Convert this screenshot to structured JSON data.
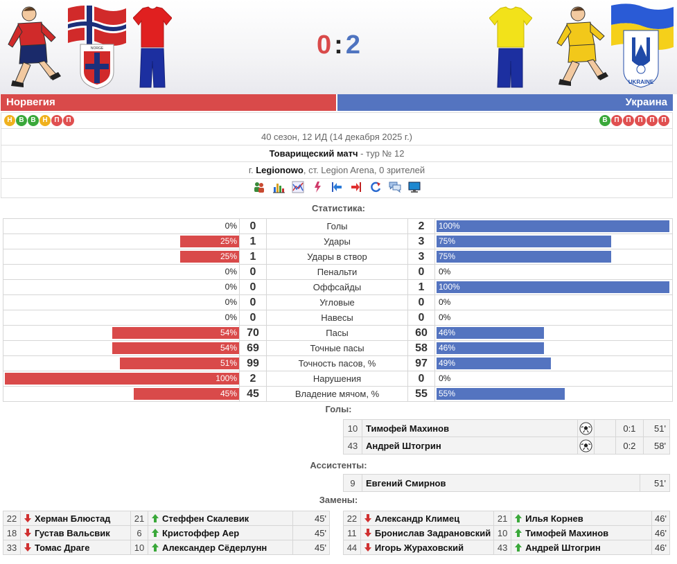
{
  "match": {
    "home_team": "Норвегия",
    "away_team": "Украина",
    "home_score": "0",
    "score_sep": ":",
    "away_score": "2",
    "home_form": [
      "Н",
      "В",
      "В",
      "Н",
      "П",
      "П"
    ],
    "away_form": [
      "В",
      "П",
      "П",
      "П",
      "П",
      "П"
    ],
    "season_info": "40 сезон, 12 ИД (14 декабря 2025 г.)",
    "match_type": "Товарищеский матч",
    "round": " - тур № 12",
    "city_prefix": "г. ",
    "city": "Legionowo",
    "venue": ", ст. Legion Arena, 0 зрителей",
    "ukraine_badge_text": "UKRAINE",
    "norway_badge_text": "NORGE"
  },
  "toolbar_icons": [
    "players-icon",
    "bar-chart-icon",
    "line-chart-icon",
    "events-icon",
    "arrow-left-icon",
    "arrow-right-icon",
    "refresh-icon",
    "comments-icon",
    "monitor-icon"
  ],
  "colors": {
    "home": "#d94a4a",
    "away": "#5474c0",
    "form_win": "#3aa83a",
    "form_draw": "#f0b11e",
    "form_loss": "#e05050"
  },
  "sections": {
    "stats": "Статистика:",
    "goals": "Голы:",
    "assists": "Ассистенты:",
    "subs": "Замены:"
  },
  "stats": [
    {
      "label": "Голы",
      "home": "0",
      "away": "2",
      "home_pct": "0%",
      "away_pct": "100%",
      "home_frac": 0,
      "away_frac": 1.0
    },
    {
      "label": "Удары",
      "home": "1",
      "away": "3",
      "home_pct": "25%",
      "away_pct": "75%",
      "home_frac": 0.25,
      "away_frac": 0.75
    },
    {
      "label": "Удары в створ",
      "home": "1",
      "away": "3",
      "home_pct": "25%",
      "away_pct": "75%",
      "home_frac": 0.25,
      "away_frac": 0.75
    },
    {
      "label": "Пенальти",
      "home": "0",
      "away": "0",
      "home_pct": "0%",
      "away_pct": "0%",
      "home_frac": 0,
      "away_frac": 0
    },
    {
      "label": "Оффсайды",
      "home": "0",
      "away": "1",
      "home_pct": "0%",
      "away_pct": "100%",
      "home_frac": 0,
      "away_frac": 1.0
    },
    {
      "label": "Угловые",
      "home": "0",
      "away": "0",
      "home_pct": "0%",
      "away_pct": "0%",
      "home_frac": 0,
      "away_frac": 0
    },
    {
      "label": "Навесы",
      "home": "0",
      "away": "0",
      "home_pct": "0%",
      "away_pct": "0%",
      "home_frac": 0,
      "away_frac": 0
    },
    {
      "label": "Пасы",
      "home": "70",
      "away": "60",
      "home_pct": "54%",
      "away_pct": "46%",
      "home_frac": 0.54,
      "away_frac": 0.46
    },
    {
      "label": "Точные пасы",
      "home": "69",
      "away": "58",
      "home_pct": "54%",
      "away_pct": "46%",
      "home_frac": 0.54,
      "away_frac": 0.46
    },
    {
      "label": "Точность пасов, %",
      "home": "99",
      "away": "97",
      "home_pct": "51%",
      "away_pct": "49%",
      "home_frac": 0.51,
      "away_frac": 0.49
    },
    {
      "label": "Нарушения",
      "home": "2",
      "away": "0",
      "home_pct": "100%",
      "away_pct": "0%",
      "home_frac": 1.0,
      "away_frac": 0
    },
    {
      "label": "Владение мячом, %",
      "home": "45",
      "away": "55",
      "home_pct": "45%",
      "away_pct": "55%",
      "home_frac": 0.45,
      "away_frac": 0.55
    }
  ],
  "goals": [
    {
      "num": "10",
      "name": "Тимофей Махинов",
      "score": "0:1",
      "minute": "51'"
    },
    {
      "num": "43",
      "name": "Андрей Штогрин",
      "score": "0:2",
      "minute": "58'"
    }
  ],
  "assists": [
    {
      "num": "9",
      "name": "Евгений Смирнов",
      "minute": "51'"
    }
  ],
  "subs_home": [
    {
      "out_num": "22",
      "out_name": "Херман Блюстад",
      "in_num": "21",
      "in_name": "Стеффен Скалевик",
      "minute": "45'"
    },
    {
      "out_num": "18",
      "out_name": "Густав Вальсвик",
      "in_num": "6",
      "in_name": "Кристоффер Аер",
      "minute": "45'"
    },
    {
      "out_num": "33",
      "out_name": "Томас Драге",
      "in_num": "10",
      "in_name": "Александер Сёдерлунн",
      "minute": "45'"
    }
  ],
  "subs_away": [
    {
      "out_num": "22",
      "out_name": "Александр Климец",
      "in_num": "21",
      "in_name": "Илья Корнев",
      "minute": "46'"
    },
    {
      "out_num": "11",
      "out_name": "Бронислав Задрановский",
      "in_num": "10",
      "in_name": "Тимофей Махинов",
      "minute": "46'"
    },
    {
      "out_num": "44",
      "out_name": "Игорь Жураховский",
      "in_num": "43",
      "in_name": "Андрей Штогрин",
      "minute": "46'"
    }
  ]
}
